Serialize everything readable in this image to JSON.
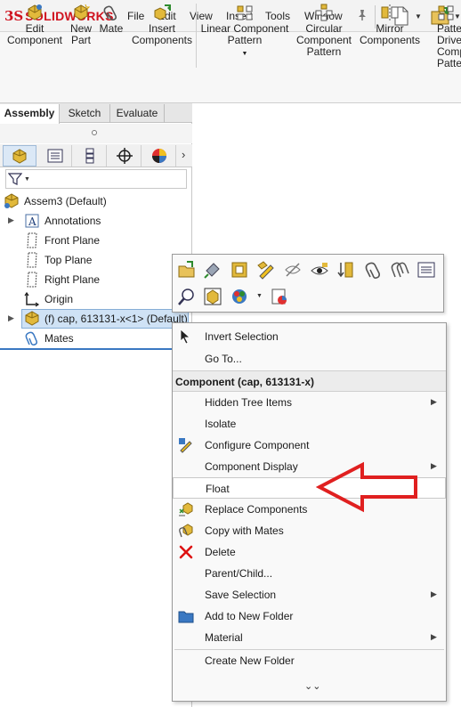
{
  "app": {
    "logo_prefix": "3S",
    "logo_name": "SOLIDWORKS"
  },
  "menubar": {
    "items": [
      "File",
      "Edit",
      "View",
      "Insert",
      "Tools",
      "Window"
    ]
  },
  "commands": [
    {
      "line1": "Edit",
      "line2": "Component"
    },
    {
      "line1": "New",
      "line2": "Part"
    },
    {
      "line1": "Mate",
      "line2": ""
    },
    {
      "line1": "Insert",
      "line2": "Components"
    },
    {
      "line1": "Linear Component",
      "line2": "Pattern"
    },
    {
      "line1": "Circular",
      "line2": "Component",
      "line3": "Pattern"
    },
    {
      "line1": "Mirror",
      "line2": "Components"
    },
    {
      "line1": "Patte",
      "line2": "Drive",
      "line3": "Compon",
      "line4": "Patte"
    }
  ],
  "command_tabs": [
    "Assembly",
    "Sketch",
    "Evaluate"
  ],
  "tree": {
    "root": "Assem3  (Default)",
    "items": [
      "Annotations",
      "Front Plane",
      "Top Plane",
      "Right Plane",
      "Origin",
      "(f) cap, 613131-x<1> (Default)",
      "Mates"
    ]
  },
  "context_menu": {
    "items_top": [
      "Invert Selection",
      "Go To..."
    ],
    "heading": "Component (cap, 613131-x)",
    "items": [
      "Hidden Tree Items",
      "Isolate",
      "Configure Component",
      "Component Display",
      "Float",
      "Replace Components",
      "Copy with Mates",
      "Delete",
      "Parent/Child...",
      "Save Selection",
      "Add to New Folder",
      "Material"
    ],
    "items_bottom": [
      "Create New Folder"
    ],
    "highlighted": "Float"
  },
  "colors": {
    "accent": "#d0131f",
    "selection": "#cfe2f5",
    "annotation_arrow": "#e02020"
  }
}
